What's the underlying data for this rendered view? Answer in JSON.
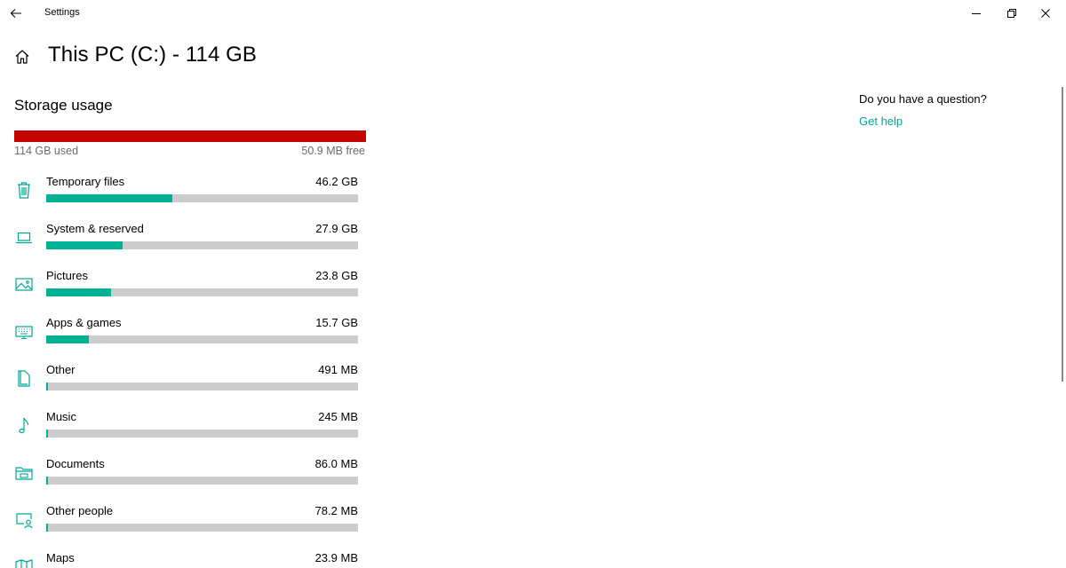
{
  "window": {
    "title": "Settings"
  },
  "header": {
    "title": "This PC (C:) - 114 GB"
  },
  "storage": {
    "section_title": "Storage usage",
    "used_label": "114 GB used",
    "free_label": "50.9 MB free",
    "used_fraction": 0.9996,
    "bar_color": "#c50500"
  },
  "categories": [
    {
      "name": "Temporary files",
      "size": "46.2 GB",
      "fraction": 0.405,
      "icon": "trash-icon"
    },
    {
      "name": "System & reserved",
      "size": "27.9 GB",
      "fraction": 0.245,
      "icon": "laptop-icon"
    },
    {
      "name": "Pictures",
      "size": "23.8 GB",
      "fraction": 0.209,
      "icon": "picture-icon"
    },
    {
      "name": "Apps & games",
      "size": "15.7 GB",
      "fraction": 0.138,
      "icon": "keyboard-monitor-icon"
    },
    {
      "name": "Other",
      "size": "491 MB",
      "fraction": 0.0043,
      "icon": "other-files-icon"
    },
    {
      "name": "Music",
      "size": "245 MB",
      "fraction": 0.0021,
      "icon": "music-note-icon"
    },
    {
      "name": "Documents",
      "size": "86.0 MB",
      "fraction": 0.0008,
      "icon": "folder-icon"
    },
    {
      "name": "Other people",
      "size": "78.2 MB",
      "fraction": 0.0007,
      "icon": "person-screen-icon"
    },
    {
      "name": "Maps",
      "size": "23.9 MB",
      "fraction": 0.0002,
      "icon": "map-icon"
    }
  ],
  "help": {
    "question": "Do you have a question?",
    "link": "Get help"
  },
  "colors": {
    "accent": "#00b294",
    "link": "#00a693",
    "bar_track": "#cccccc"
  }
}
